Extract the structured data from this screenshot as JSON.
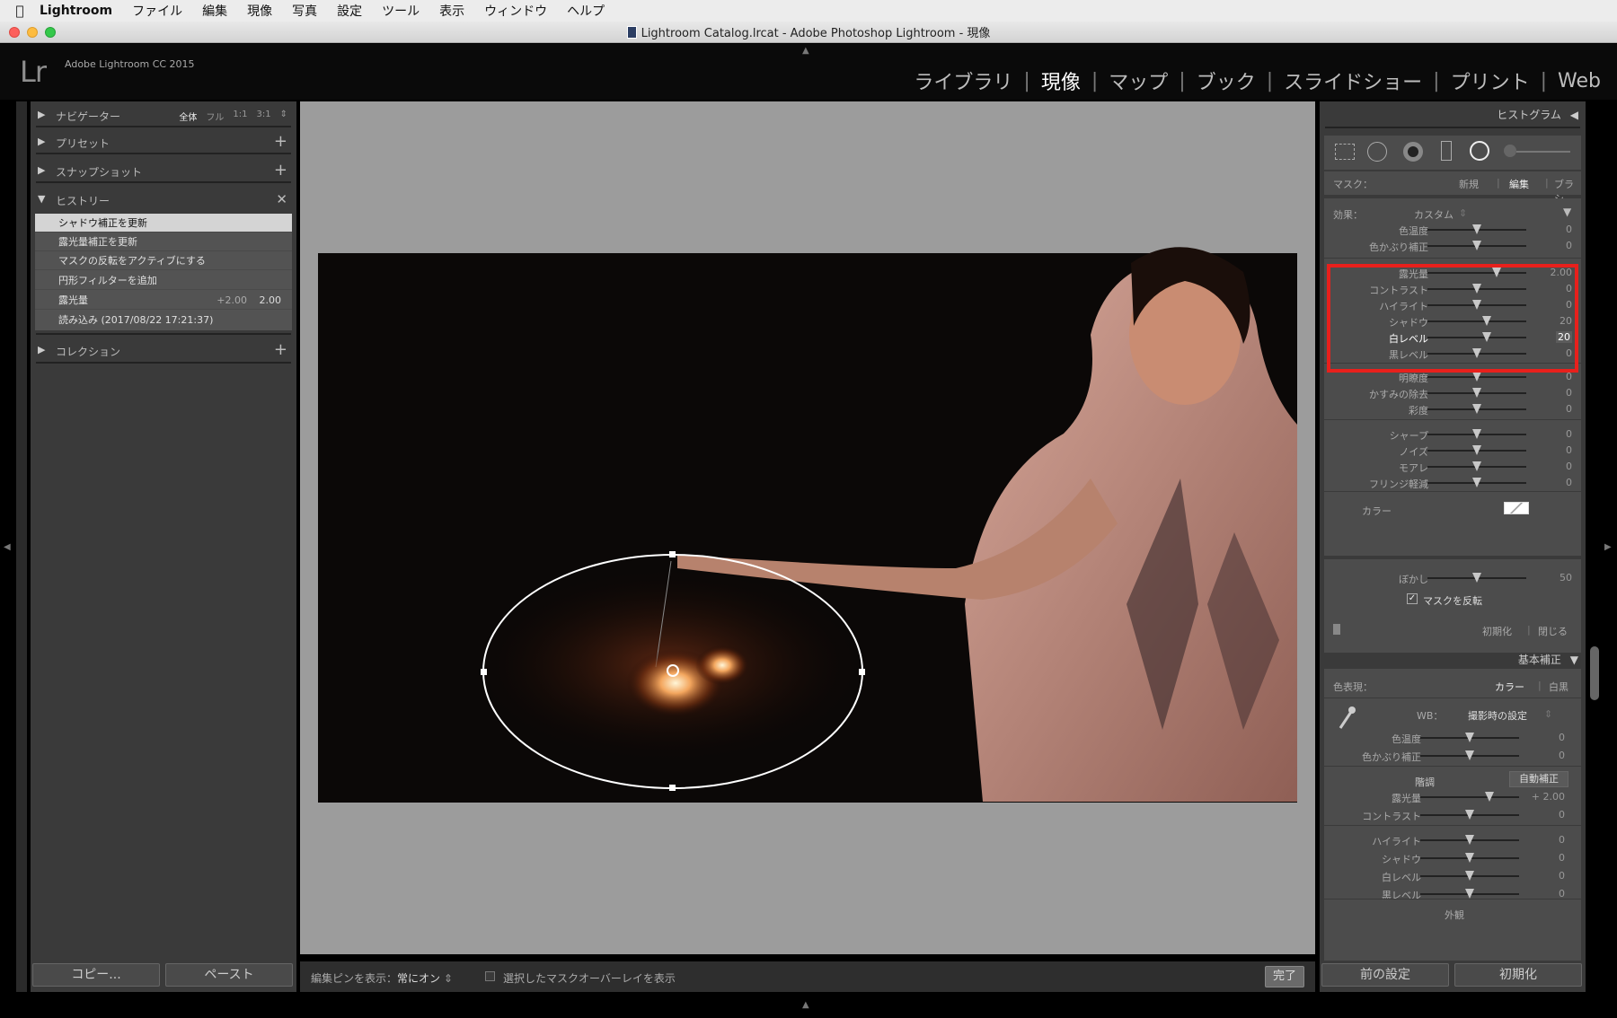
{
  "menubar": {
    "app": "Lightroom",
    "items": [
      "ファイル",
      "編集",
      "現像",
      "写真",
      "設定",
      "ツール",
      "表示",
      "ウィンドウ",
      "ヘルプ"
    ]
  },
  "window": {
    "title": "Lightroom Catalog.lrcat - Adobe Photoshop Lightroom - 現像"
  },
  "header": {
    "logo": "Lr",
    "product": "Adobe Lightroom CC 2015",
    "modules": [
      "ライブラリ",
      "現像",
      "マップ",
      "ブック",
      "スライドショー",
      "プリント",
      "Web"
    ],
    "active_module": "現像"
  },
  "left_panel": {
    "navigator": {
      "title": "ナビゲーター",
      "options": [
        "全体",
        "フル",
        "1:1",
        "3:1"
      ],
      "selected": "全体"
    },
    "presets": {
      "title": "プリセット"
    },
    "snapshots": {
      "title": "スナップショット"
    },
    "history": {
      "title": "ヒストリー",
      "items": [
        {
          "label": "シャドウ補正を更新",
          "v1": "",
          "v2": ""
        },
        {
          "label": "露光量補正を更新",
          "v1": "",
          "v2": ""
        },
        {
          "label": "マスクの反転をアクティブにする",
          "v1": "",
          "v2": ""
        },
        {
          "label": "円形フィルターを追加",
          "v1": "",
          "v2": ""
        },
        {
          "label": "露光量",
          "v1": "+2.00",
          "v2": "2.00"
        },
        {
          "label": "読み込み (2017/08/22 17:21:37)",
          "v1": "",
          "v2": ""
        }
      ]
    },
    "collections": {
      "title": "コレクション"
    },
    "copy_button": "コピー...",
    "paste_button": "ペースト"
  },
  "toolbar": {
    "pins_label": "編集ピンを表示：",
    "pins_value": "常にオン",
    "overlay_label": "選択したマスクオーバーレイを表示",
    "done": "完了"
  },
  "right_panel": {
    "histogram_title": "ヒストグラム",
    "mask": {
      "label": "マスク：",
      "new": "新規",
      "edit": "編集",
      "brush": "ブラシ"
    },
    "effect": {
      "label": "効果：",
      "value": "カスタム"
    },
    "filter_sliders": {
      "group1": [
        {
          "label": "色温度",
          "value": "0",
          "pos": 0.5
        },
        {
          "label": "色かぶり補正",
          "value": "0",
          "pos": 0.5
        }
      ],
      "group2": [
        {
          "label": "露光量",
          "value": "2.00",
          "pos": 0.7
        },
        {
          "label": "コントラスト",
          "value": "0",
          "pos": 0.5
        },
        {
          "label": "ハイライト",
          "value": "0",
          "pos": 0.5
        },
        {
          "label": "シャドウ",
          "value": "20",
          "pos": 0.6
        },
        {
          "label": "白レベル",
          "value": "20",
          "pos": 0.6
        },
        {
          "label": "黒レベル",
          "value": "0",
          "pos": 0.5
        }
      ],
      "group3": [
        {
          "label": "明瞭度",
          "value": "0",
          "pos": 0.5
        },
        {
          "label": "かすみの除去",
          "value": "0",
          "pos": 0.5
        },
        {
          "label": "彩度",
          "value": "0",
          "pos": 0.5
        }
      ],
      "group4": [
        {
          "label": "シャープ",
          "value": "0",
          "pos": 0.5
        },
        {
          "label": "ノイズ",
          "value": "0",
          "pos": 0.5
        },
        {
          "label": "モアレ",
          "value": "0",
          "pos": 0.5
        },
        {
          "label": "フリンジ軽減",
          "value": "0",
          "pos": 0.5
        }
      ]
    },
    "color_label": "カラー",
    "feather": {
      "label": "ぼかし",
      "value": "50",
      "pos": 0.5
    },
    "invert_mask": "マスクを反転",
    "reset": "初期化",
    "close": "閉じる",
    "basic": {
      "title": "基本補正",
      "treatment_label": "色表現：",
      "color": "カラー",
      "bw": "白黒",
      "wb_label": "WB：",
      "wb_value": "撮影時の設定",
      "wb_sliders": [
        {
          "label": "色温度",
          "value": "0",
          "pos": 0.5
        },
        {
          "label": "色かぶり補正",
          "value": "0",
          "pos": 0.5
        }
      ],
      "tone_label": "階調",
      "auto": "自動補正",
      "tone_sliders": [
        {
          "label": "露光量",
          "value": "+ 2.00",
          "pos": 0.7
        },
        {
          "label": "コントラスト",
          "value": "0",
          "pos": 0.5
        }
      ],
      "presence_sliders": [
        {
          "label": "ハイライト",
          "value": "0",
          "pos": 0.5
        },
        {
          "label": "シャドウ",
          "value": "0",
          "pos": 0.5
        },
        {
          "label": "白レベル",
          "value": "0",
          "pos": 0.5
        },
        {
          "label": "黒レベル",
          "value": "0",
          "pos": 0.5
        }
      ],
      "presence_title": "外観"
    },
    "prev_button": "前の設定",
    "reset_button": "初期化"
  },
  "colors": {
    "highlight": "#e8201c",
    "bg": "#3a3a3a"
  }
}
